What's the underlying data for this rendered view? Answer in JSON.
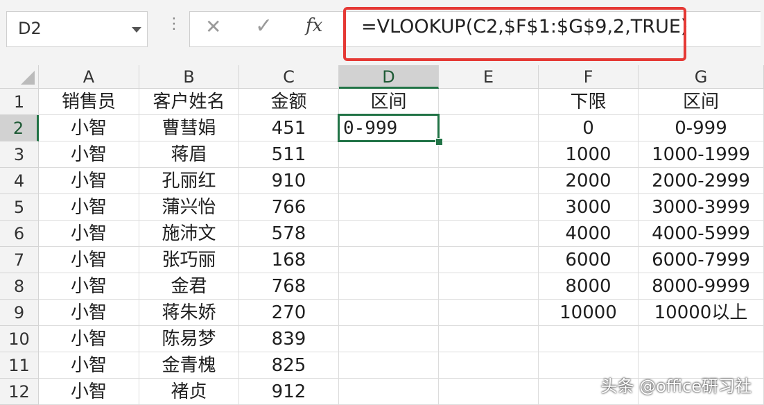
{
  "name_box": {
    "value": "D2"
  },
  "formula_bar": {
    "cancel_icon": "cancel-x",
    "enter_icon": "enter-check",
    "fx_label": "fx",
    "formula": "=VLOOKUP(C2,$F$1:$G$9,2,TRUE)",
    "highlight_color": "#e53935"
  },
  "columns": [
    "A",
    "B",
    "C",
    "D",
    "E",
    "F",
    "G"
  ],
  "rows": [
    "1",
    "2",
    "3",
    "4",
    "5",
    "6",
    "7",
    "8",
    "9",
    "10",
    "11",
    "12"
  ],
  "selected_cell": {
    "column": "D",
    "row": "2"
  },
  "cells": {
    "A": [
      "销售员",
      "小智",
      "小智",
      "小智",
      "小智",
      "小智",
      "小智",
      "小智",
      "小智",
      "小智",
      "小智",
      "小智"
    ],
    "B": [
      "客户姓名",
      "曹彗娟",
      "蒋眉",
      "孔丽红",
      "蒲兴怡",
      "施沛文",
      "张巧丽",
      "金君",
      "蒋朱娇",
      "陈易梦",
      "金青槐",
      "褚贞"
    ],
    "C": [
      "金额",
      "451",
      "511",
      "910",
      "766",
      "578",
      "168",
      "768",
      "270",
      "839",
      "825",
      "912"
    ],
    "D": [
      "区间",
      "0-999",
      "",
      "",
      "",
      "",
      "",
      "",
      "",
      "",
      "",
      ""
    ],
    "E": [
      "",
      "",
      "",
      "",
      "",
      "",
      "",
      "",
      "",
      "",
      "",
      ""
    ],
    "F": [
      "下限",
      "0",
      "1000",
      "2000",
      "3000",
      "4000",
      "6000",
      "8000",
      "10000",
      "",
      "",
      ""
    ],
    "G": [
      "区间",
      "0-999",
      "1000-1999",
      "2000-2999",
      "3000-3999",
      "4000-5999",
      "6000-7999",
      "8000-9999",
      "10000以上",
      "",
      "",
      ""
    ]
  },
  "watermark": "头条 @office研习社",
  "accent_color": "#217346"
}
